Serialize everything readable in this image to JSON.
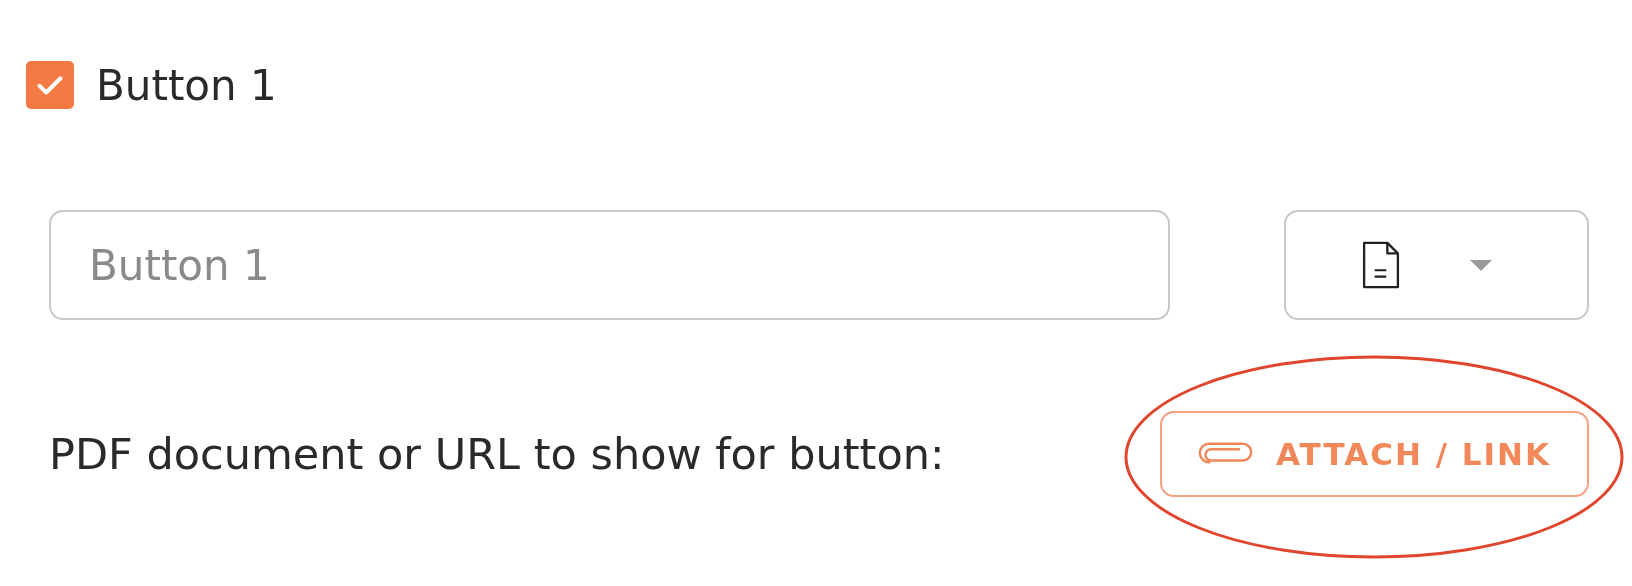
{
  "checkbox": {
    "label": "Button 1",
    "checked": true
  },
  "name_field": {
    "placeholder": "Button 1"
  },
  "attachment_label": "PDF document or URL to show for button:",
  "attach_button": {
    "label": "ATTACH / LINK"
  }
}
